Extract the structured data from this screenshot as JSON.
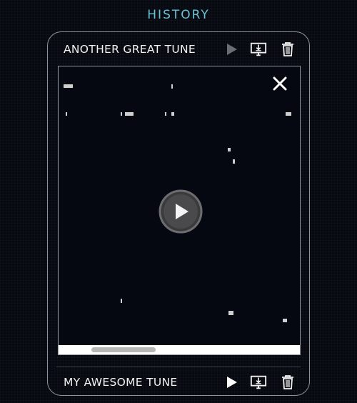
{
  "history": {
    "title": "HISTORY"
  },
  "tunes": [
    {
      "name": "ANOTHER GREAT TUNE",
      "play_state": "disabled"
    },
    {
      "name": "MY AWESOME TUNE",
      "play_state": "enabled"
    }
  ],
  "icons": {
    "play": "play-icon",
    "download": "download-monitor-icon",
    "delete": "trash-icon",
    "close": "close-icon",
    "video_play": "play-circle-icon"
  },
  "colors": {
    "accent": "#69c3d6",
    "border": "#8f959c",
    "background": "#06090f",
    "text": "#f2f2f2",
    "play_disabled": "#6a6e74"
  }
}
